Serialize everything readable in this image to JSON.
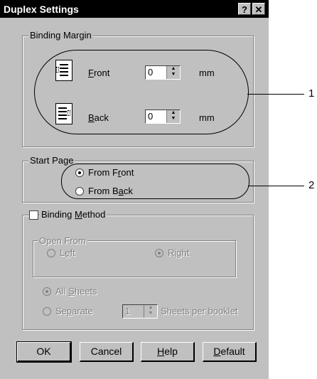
{
  "window": {
    "title": "Duplex Settings",
    "help_button": "?",
    "close_button": "✕"
  },
  "binding_margin": {
    "label": "Binding Margin",
    "front": {
      "label_mnemonic": "F",
      "label_rest": "ront",
      "value": "0",
      "unit": "mm"
    },
    "back": {
      "label_mnemonic": "B",
      "label_rest": "ack",
      "value": "0",
      "unit": "mm"
    }
  },
  "start_page": {
    "label": "Start Page",
    "from_front": {
      "pre": "From F",
      "mnemonic": "r",
      "post": "ont",
      "selected": true
    },
    "from_back": {
      "pre": "From B",
      "mnemonic": "a",
      "post": "ck",
      "selected": false
    }
  },
  "binding_method": {
    "checkbox_pre": "Binding ",
    "checkbox_mnemonic": "M",
    "checkbox_post": "ethod",
    "checked": false,
    "open_from": {
      "label": "Open From",
      "left": {
        "pre": "L",
        "mnemonic": "e",
        "post": "ft",
        "selected": false
      },
      "right": {
        "pre": "R",
        "mnemonic": "i",
        "post": "ght",
        "selected": true
      }
    },
    "all_sheets": {
      "pre": "All ",
      "mnemonic": "S",
      "post": "heets",
      "selected": true
    },
    "separate": {
      "pre": "Se",
      "mnemonic": "p",
      "post": "arate",
      "selected": false
    },
    "sheets_value": "1",
    "sheets_label": "Sheets per booklet"
  },
  "buttons": {
    "ok": "OK",
    "cancel": "Cancel",
    "help_mnemonic": "H",
    "help_rest": "elp",
    "default_mnemonic": "D",
    "default_rest": "efault"
  },
  "callouts": {
    "one": "1",
    "two": "2"
  }
}
